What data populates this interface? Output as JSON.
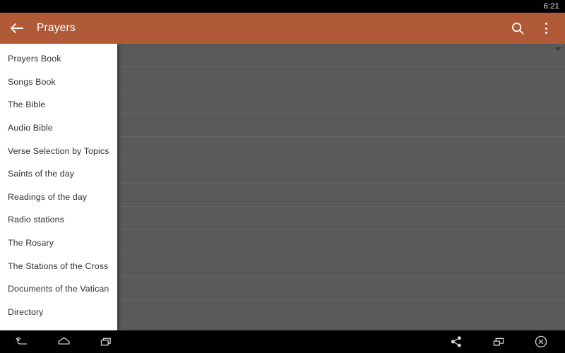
{
  "status_bar": {
    "time": "6:21"
  },
  "app_bar": {
    "back_icon": "back-arrow-icon",
    "title": "Prayers",
    "search_icon": "search-icon",
    "overflow_icon": "overflow-menu-icon"
  },
  "drawer": {
    "items": [
      {
        "label": "Prayers Book"
      },
      {
        "label": "Songs Book"
      },
      {
        "label": "The Bible"
      },
      {
        "label": "Audio Bible"
      },
      {
        "label": "Verse Selection by Topics"
      },
      {
        "label": "Saints of the day"
      },
      {
        "label": "Readings of the day"
      },
      {
        "label": "Radio stations"
      },
      {
        "label": "The Rosary"
      },
      {
        "label": "The Stations of the Cross"
      },
      {
        "label": "Documents of the Vatican"
      },
      {
        "label": "Directory"
      },
      {
        "label": ""
      }
    ]
  },
  "content": {
    "row_count": 13,
    "scroll_indicator_icon": "scroll-down-triangle-icon"
  },
  "nav_bar": {
    "back_icon": "nav-back-icon",
    "home_icon": "nav-home-icon",
    "recents_icon": "nav-recents-icon",
    "share_icon": "share-icon",
    "pip_icon": "picture-in-picture-icon",
    "close_icon": "close-circle-icon"
  },
  "colors": {
    "accent": "#b05a38",
    "content_bg": "#5a5a5a",
    "drawer_bg": "#ffffff",
    "system_bg": "#000000"
  }
}
